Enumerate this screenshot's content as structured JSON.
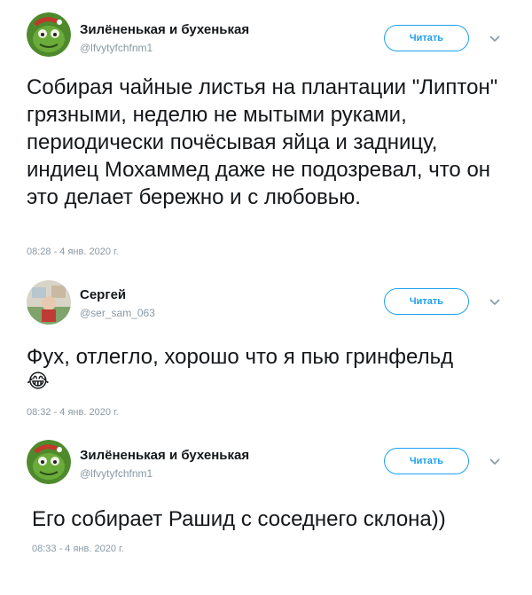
{
  "tweets": [
    {
      "author": {
        "name": "Зилёненькая и бухенькая",
        "handle": "@lfvytyfchfnm1"
      },
      "follow_label": "Читать",
      "text": "Собирая чайные листья на плантации \"Липтон\" грязными, неделю не мытыми руками, периодически почёсывая яйца и задницу, индиец Мохаммед даже не подозревал, что он это делает бережно и с любовью.",
      "timestamp": "08:28 - 4 янв. 2020 г."
    },
    {
      "author": {
        "name": "Сергей",
        "handle": "@ser_sam_063"
      },
      "follow_label": "Читать",
      "text": "Фух, отлегло, хорошо что я пью гринфельд",
      "emoji": "😂",
      "timestamp": "08:32 - 4 янв. 2020 г."
    },
    {
      "author": {
        "name": "Зилёненькая и бухенькая",
        "handle": "@lfvytyfchfnm1"
      },
      "follow_label": "Читать",
      "text": "Его собирает Рашид с соседнего склона))",
      "timestamp": "08:33 - 4 янв. 2020 г."
    }
  ],
  "icons": {
    "avatar_green": "green-cartoon-avatar",
    "avatar_sergey": "photo-avatar",
    "more": "chevron-down-icon"
  },
  "colors": {
    "accent": "#1da1f2",
    "muted": "#8899a6",
    "text": "#14171a"
  }
}
